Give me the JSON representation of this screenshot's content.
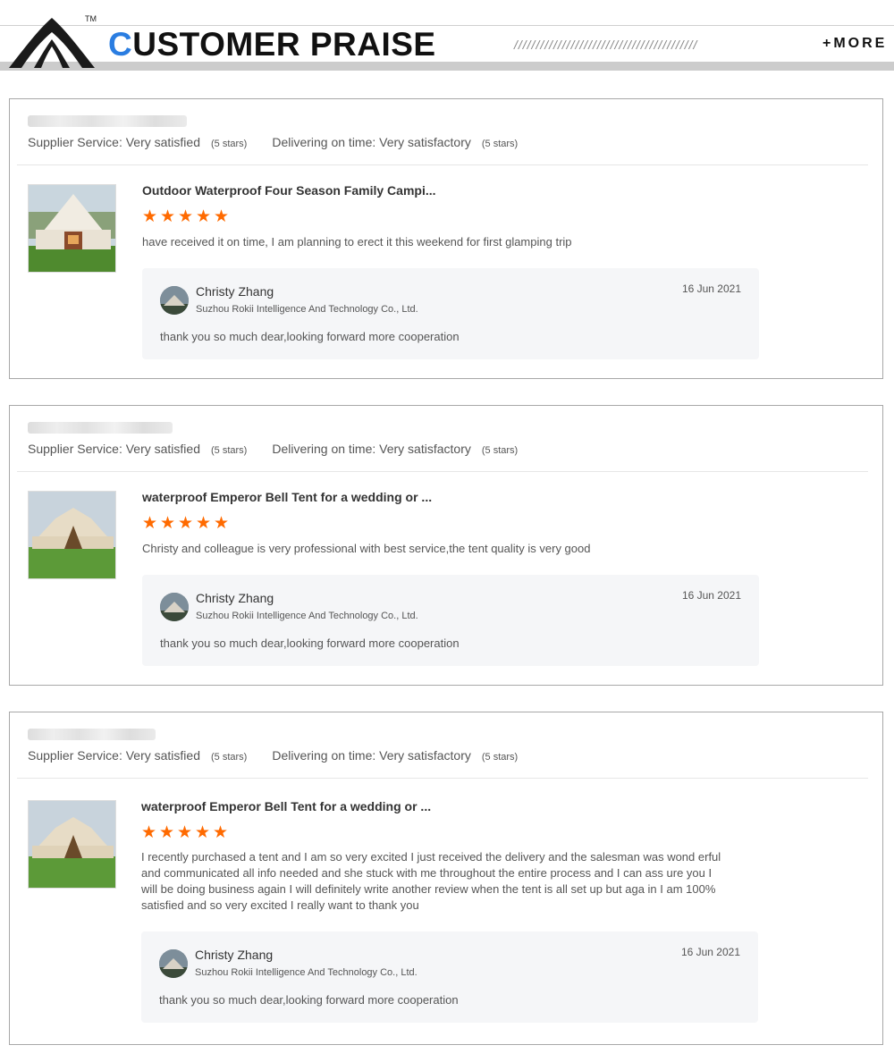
{
  "header": {
    "tm": "TM",
    "title_first": "C",
    "title_rest": "USTOMER PRAISE",
    "slashes": "//////////////////////////////////////////",
    "more": "+MORE"
  },
  "reviews": [
    {
      "supplier_service": "Supplier Service: Very satisfied",
      "supplier_stars": "(5 stars)",
      "delivery": "Delivering on time: Very satisfactory",
      "delivery_stars": "(5 stars)",
      "product_title": "Outdoor Waterproof Four Season Family Campi...",
      "rating": 5,
      "review_text": "have received it on time, I am planning to erect it this weekend for first glamping trip",
      "reply": {
        "name": "Christy Zhang",
        "company": "Suzhou Rokii Intelligence And Technology Co., Ltd.",
        "date": "16 Jun 2021",
        "message": "thank you so much dear,looking forward more cooperation"
      }
    },
    {
      "supplier_service": "Supplier Service: Very satisfied",
      "supplier_stars": "(5 stars)",
      "delivery": "Delivering on time: Very satisfactory",
      "delivery_stars": "(5 stars)",
      "product_title": "waterproof Emperor Bell Tent for a wedding or ...",
      "rating": 5,
      "review_text": "Christy and colleague is very professional with best service,the tent quality is very good",
      "reply": {
        "name": "Christy Zhang",
        "company": "Suzhou Rokii Intelligence And Technology Co., Ltd.",
        "date": "16 Jun 2021",
        "message": "thank you so much dear,looking forward more cooperation"
      }
    },
    {
      "supplier_service": "Supplier Service: Very satisfied",
      "supplier_stars": "(5 stars)",
      "delivery": "Delivering on time: Very satisfactory",
      "delivery_stars": "(5 stars)",
      "product_title": "waterproof Emperor Bell Tent for a wedding or ...",
      "rating": 5,
      "review_text": "I recently purchased a tent and I am so very excited I just received the delivery and the salesman was wond erful and communicated all info needed and she stuck with me throughout the entire process and I can ass ure you I will be doing business again I will definitely write another review when the tent is all set up but aga in I am 100% satisfied and so very excited I really want to thank you",
      "reply": {
        "name": "Christy Zhang",
        "company": "Suzhou Rokii Intelligence And Technology Co., Ltd.",
        "date": "16 Jun 2021",
        "message": "thank you so much dear,looking forward more cooperation"
      }
    }
  ],
  "colors": {
    "accent": "#2a7de1",
    "star": "#ff6a00"
  },
  "icons": {
    "star": "star-icon",
    "more": "plus-icon"
  }
}
